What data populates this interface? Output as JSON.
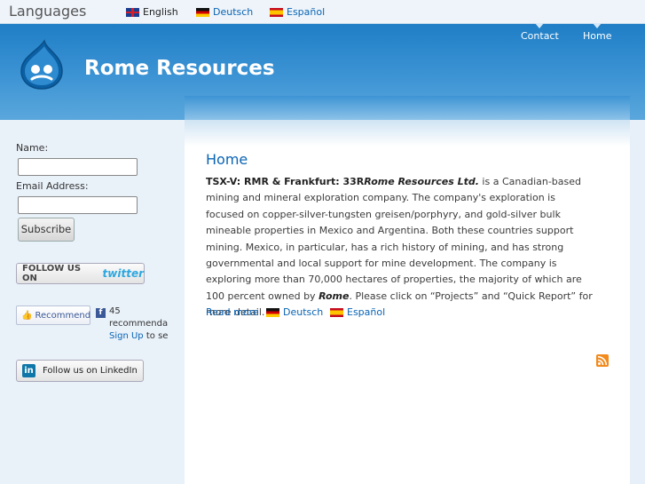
{
  "langbar": {
    "title": "Languages",
    "items": [
      {
        "label": "English",
        "flag": "uk-flag-icon"
      },
      {
        "label": "Deutsch",
        "flag": "germany-flag-icon"
      },
      {
        "label": "Español",
        "flag": "spain-flag-icon"
      }
    ]
  },
  "header": {
    "site_name": "Rome Resources",
    "nav": [
      {
        "label": "Contact"
      },
      {
        "label": "Home"
      }
    ],
    "colors": {
      "header": "#1f7ec6",
      "link": "#0a64b4"
    }
  },
  "sidebar": {
    "name_label": "Name:",
    "email_label": "Email Address:",
    "subscribe_label": "Subscribe",
    "twitter_prefix": "FOLLOW US ON",
    "twitter_brand": "twitter",
    "recommend_label": "Recommend",
    "fb_count": "45",
    "fb_text": "recommenda",
    "fb_signup": "Sign Up",
    "fb_signup_rest": "to se",
    "linkedin_label": "Follow us on LinkedIn"
  },
  "main": {
    "title": "Home",
    "lead_bold": "TSX-V: RMR  &  Frankfurt: 33R",
    "lead_italic": "Rome Resources Ltd.",
    "para1": " is a Canadian-based mining and mineral exploration company. The company's exploration is focused on copper-silver-tungsten greisen/porphyry, and gold-silver bulk mineable properties in Mexico and Argentina. Both these countries support mining. Mexico, in particular, has a rich history of mining, and has strong governmental and local support for mine development. The company is exploring more than 70,000 hectares of properties, the majority of which are 100 percent owned by ",
    "rome_italic": "Rome",
    "para2": ". Please click on “Projects” and “Quick Report” for more detail.",
    "read_more": "Read more",
    "lang_links": [
      {
        "label": "Deutsch"
      },
      {
        "label": "Español"
      }
    ]
  }
}
